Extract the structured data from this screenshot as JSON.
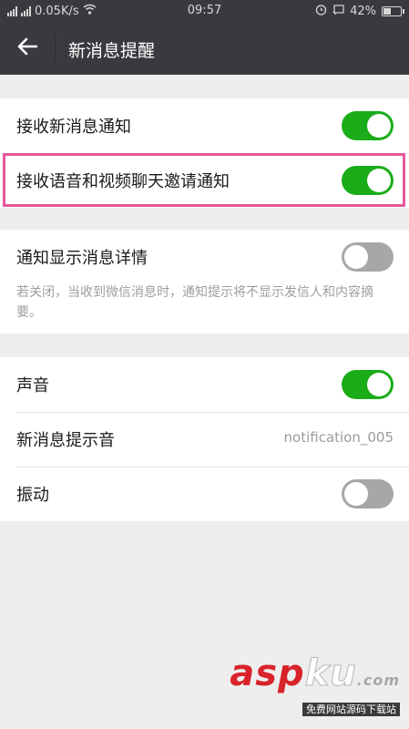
{
  "status_bar": {
    "network_speed": "0.05K/s",
    "time": "09:57",
    "battery": "42%",
    "battery_level": 0.42
  },
  "header": {
    "title": "新消息提醒"
  },
  "group1": {
    "items": [
      {
        "label": "接收新消息通知",
        "toggle": "on"
      },
      {
        "label": "接收语音和视频聊天邀请通知",
        "toggle": "on"
      }
    ]
  },
  "group2": {
    "items": [
      {
        "label": "通知显示消息详情",
        "toggle": "off"
      }
    ],
    "description": "若关闭，当收到微信消息时，通知提示将不显示发信人和内容摘要。"
  },
  "group3": {
    "items": [
      {
        "label": "声音",
        "toggle": "on"
      },
      {
        "label": "新消息提示音",
        "value": "notification_005"
      },
      {
        "label": "振动",
        "toggle": "off"
      }
    ]
  },
  "watermark": {
    "main": "asp",
    "ku": "ku",
    "com": ".com",
    "sub": "免费网站源码下载站"
  },
  "colors": {
    "header_bg": "#393a3f",
    "toggle_on": "#1aad19",
    "toggle_off": "#a7a7a7",
    "highlight": "#e8579a",
    "page_bg": "#eeeeee"
  }
}
